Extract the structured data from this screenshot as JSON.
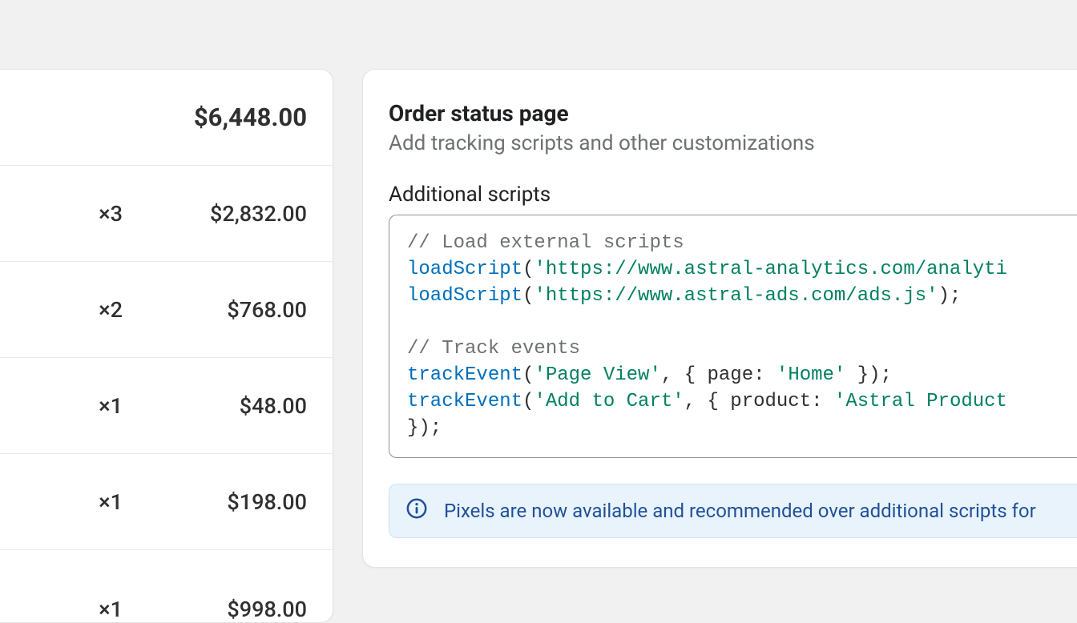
{
  "order": {
    "total": "$6,448.00",
    "items": [
      {
        "qty": "×3",
        "price": "$2,832.00"
      },
      {
        "qty": "×2",
        "price": "$768.00"
      },
      {
        "qty": "×1",
        "price": "$48.00"
      },
      {
        "qty": "×1",
        "price": "$198.00"
      },
      {
        "qty": "×1",
        "price": "$998.00"
      }
    ]
  },
  "settings": {
    "title": "Order status page",
    "subtitle": "Add tracking scripts and other customizations",
    "scriptsLabel": "Additional scripts",
    "code": {
      "c1": "// Load external scripts",
      "fn_load": "loadScript",
      "s_url1": "'https://www.astral-analytics.com/analyti",
      "s_url2": "'https://www.astral-ads.com/ads.js'",
      "c2": "// Track events",
      "fn_track": "trackEvent",
      "s_pv": "'Page View'",
      "s_home": "'Home'",
      "s_atc": "'Add to Cart'",
      "s_prod": "'Astral Product",
      "k_page": "page:",
      "k_product": "product:",
      "paren_open": "(",
      "paren_close": ");",
      "brace_open": "{ ",
      "brace_close_inline": " }",
      "comma_sep": ", ",
      "tail": "});"
    },
    "banner": "Pixels are now available and recommended over additional scripts for"
  }
}
